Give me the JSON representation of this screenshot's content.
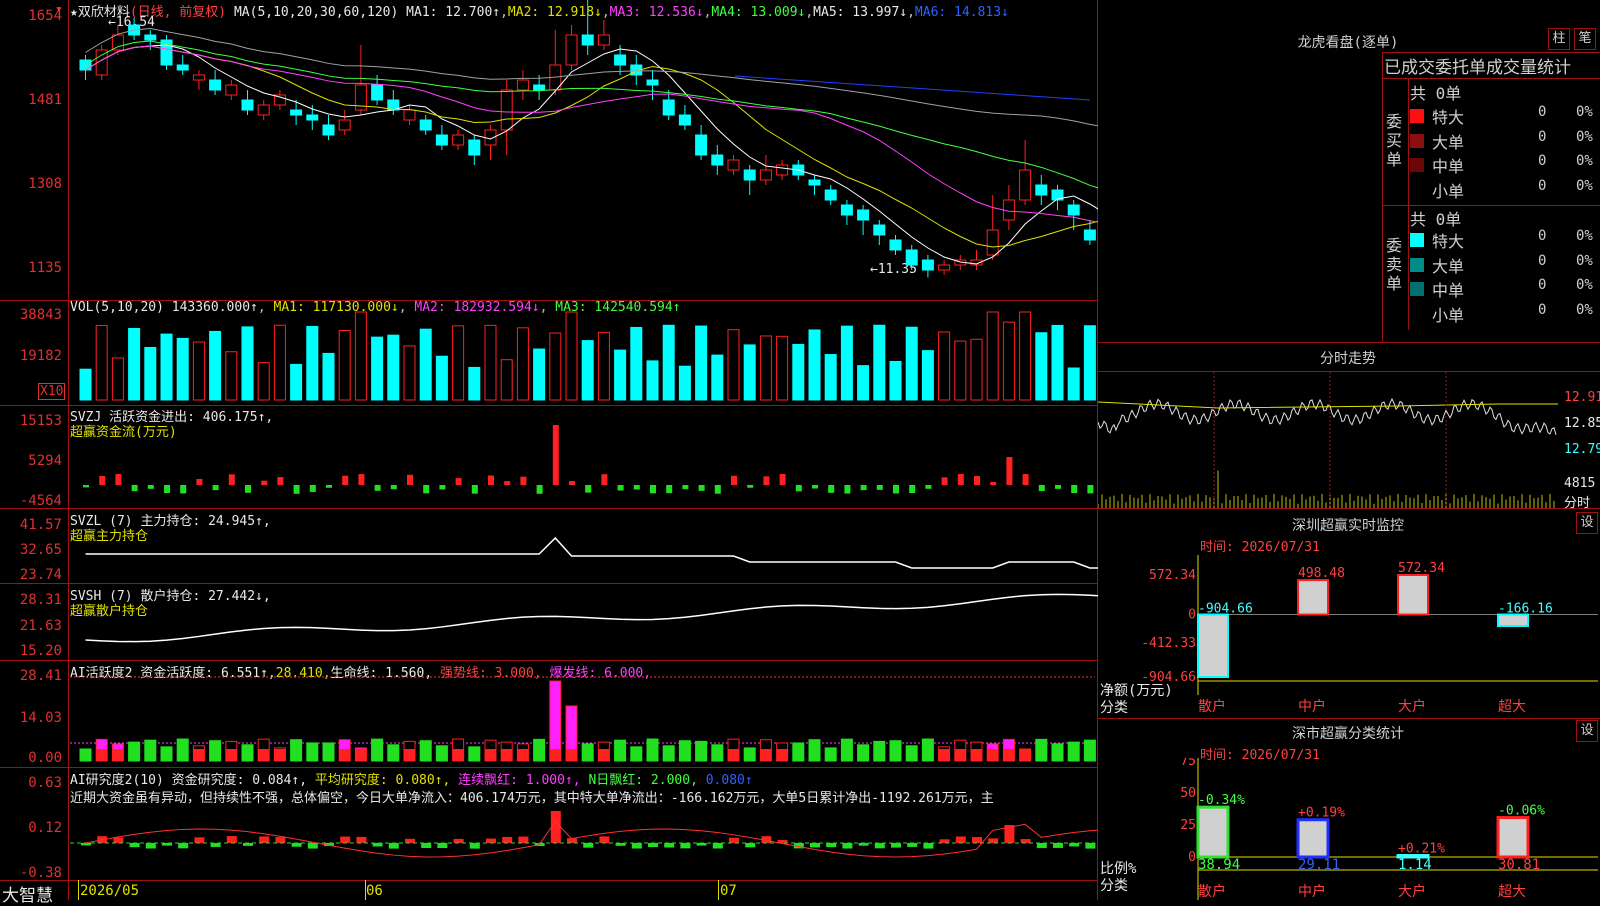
{
  "colors": {
    "up": "#ff2020",
    "down": "#00ffff",
    "ma1": "#ffffff",
    "ma2": "#e0e000",
    "ma3": "#ff40ff",
    "ma4": "#40ff40",
    "ma5": "#a0a0a0",
    "ma6": "#2040ff",
    "grid": "#a01010"
  },
  "main": {
    "stock_name": "★双欣材料",
    "mode": "(日线, 前复权)",
    "ma_params": "MA(5,10,20,30,60,120)",
    "ma1": "MA1: 12.700↑",
    "ma2": "MA2: 12.918↓",
    "ma3": "MA3: 12.536↓",
    "ma4": "MA4: 13.009↓",
    "ma5": "MA5: 13.997↓",
    "ma6": "MA6: 14.813↓",
    "y_labels": [
      "1654",
      "1481",
      "1308",
      "1135"
    ],
    "high_mark": "←16.54",
    "low_mark": "←11.35"
  },
  "volume": {
    "label": "VOL(5,10,20)",
    "value": "143360.000↑",
    "ma1": "MA1: 117130.000↓",
    "ma2": "MA2: 182932.594↓",
    "ma3": "MA3: 142540.594↑",
    "y_labels": [
      "38843",
      "19182"
    ],
    "unit": "X10"
  },
  "svzj": {
    "label": "SVZJ  活跃资金进出: 406.175↑,",
    "sub": "超赢资金流(万元)",
    "y_labels": [
      "15153",
      "5294",
      "-4564"
    ]
  },
  "svzl": {
    "label": "SVZL (7) 主力持仓: 24.945↑,",
    "sub": "超赢主力持仓",
    "y_labels": [
      "41.57",
      "32.65",
      "23.74"
    ]
  },
  "svsh": {
    "label": "SVSH (7) 散户持仓: 27.442↓,",
    "sub": "超赢散户持仓",
    "y_labels": [
      "28.31",
      "21.63",
      "15.20"
    ]
  },
  "ai_active": {
    "label1": "AI活跃度2 资金活跃度: 6.551↑,",
    "label2": "28.410,",
    "label3": "生命线: 1.560,",
    "label4": "强势线: 3.000,",
    "label5": "爆发线: 6.000,",
    "y_labels": [
      "28.41",
      "14.03",
      "0.00"
    ]
  },
  "ai_research": {
    "label1": "AI研究度2(10) 资金研究度: 0.084↑,",
    "label2": "平均研究度: 0.080↑,",
    "label3": "连续飘红: 1.000↑,",
    "label4": "N日飘红: 2.000,",
    "label5": "0.080↑",
    "comment": "近期大资金虽有异动，但持续性不强，总体偏空，今日大单净流入：406.174万元，其中特大单净流出：-166.162万元，大单5日累计净出-1192.261万元，主",
    "y_labels": [
      "0.63",
      "0.12",
      "-0.38"
    ]
  },
  "bottom": {
    "brand": "大智慧",
    "dates": [
      "2026/05",
      "06",
      "07"
    ]
  },
  "lhb": {
    "title": "龙虎看盘(逐单)",
    "btn1": "柱",
    "btn2": "笔",
    "header": "已成交委托单成交量统计",
    "buy_label": "委买单",
    "sell_label": "委卖单",
    "buy_total": "共 0单",
    "sell_total": "共 0单",
    "buy_rows": [
      {
        "name": "特大",
        "count": "0",
        "pct": "0%",
        "color": "#ff1010"
      },
      {
        "name": "大单",
        "count": "0",
        "pct": "0%",
        "color": "#8a1010"
      },
      {
        "name": "中单",
        "count": "0",
        "pct": "0%",
        "color": "#6a0808"
      },
      {
        "name": "小单",
        "count": "0",
        "pct": "0%",
        "color": "#000000"
      }
    ],
    "sell_rows": [
      {
        "name": "特大",
        "count": "0",
        "pct": "0%",
        "color": "#00ffff"
      },
      {
        "name": "大单",
        "count": "0",
        "pct": "0%",
        "color": "#008b8b"
      },
      {
        "name": "中单",
        "count": "0",
        "pct": "0%",
        "color": "#007070"
      },
      {
        "name": "小单",
        "count": "0",
        "pct": "0%",
        "color": "#000000"
      }
    ]
  },
  "intraday": {
    "title": "分时走势",
    "prices": [
      "12.91",
      "12.85",
      "12.79"
    ],
    "vol": "4815",
    "vol_unit": "分时"
  },
  "monitor": {
    "title": "深圳超赢实时监控",
    "btn": "设",
    "time": "时间: 2026/07/31",
    "y_labels": [
      "572.34",
      "0",
      "-412.33",
      "-904.66"
    ],
    "axis_label1": "净额(万元)",
    "axis_label2": "分类",
    "categories": [
      "散户",
      "中户",
      "大户",
      "超大"
    ],
    "values": [
      -904.66,
      498.48,
      572.34,
      -166.16
    ],
    "value_labels": [
      "-904.66",
      "498.48",
      "572.34",
      "-166.16"
    ]
  },
  "classify": {
    "title": "深市超赢分类统计",
    "btn": "设",
    "time": "时间: 2026/07/31",
    "y_labels": [
      "75",
      "50",
      "25",
      "0"
    ],
    "axis_label1": "比例%",
    "axis_label2": "分类",
    "categories": [
      "散户",
      "中户",
      "大户",
      "超大"
    ],
    "values": [
      38.94,
      29.11,
      1.14,
      30.81
    ],
    "changes": [
      "-0.34%",
      "+0.19%",
      "+0.21%",
      "-0.06%"
    ]
  },
  "chart_data": {
    "type": "candlestick",
    "candles": [
      [
        15.7,
        15.5,
        15.8,
        15.3
      ],
      [
        15.4,
        15.9,
        16.0,
        15.3
      ],
      [
        15.9,
        16.2,
        16.4,
        15.8
      ],
      [
        16.4,
        16.2,
        16.54,
        16.1
      ],
      [
        16.2,
        16.1,
        16.3,
        15.9
      ],
      [
        16.1,
        15.6,
        16.2,
        15.5
      ],
      [
        15.6,
        15.5,
        15.8,
        15.4
      ],
      [
        15.3,
        15.4,
        15.5,
        15.1
      ],
      [
        15.3,
        15.1,
        15.5,
        15.0
      ],
      [
        15.0,
        15.2,
        15.3,
        14.9
      ],
      [
        14.9,
        14.7,
        15.1,
        14.6
      ],
      [
        14.6,
        14.8,
        14.9,
        14.5
      ],
      [
        14.8,
        15.0,
        15.1,
        14.7
      ],
      [
        14.7,
        14.6,
        14.9,
        14.4
      ],
      [
        14.6,
        14.5,
        14.8,
        14.3
      ],
      [
        14.4,
        14.2,
        14.6,
        14.1
      ],
      [
        14.3,
        14.5,
        14.7,
        14.2
      ],
      [
        14.7,
        15.2,
        16.0,
        14.6
      ],
      [
        15.2,
        14.9,
        15.4,
        14.8
      ],
      [
        14.9,
        14.7,
        15.1,
        14.6
      ],
      [
        14.5,
        14.7,
        14.8,
        14.4
      ],
      [
        14.5,
        14.3,
        14.6,
        14.2
      ],
      [
        14.2,
        14.0,
        14.4,
        13.9
      ],
      [
        14.0,
        14.2,
        14.3,
        13.9
      ],
      [
        14.1,
        13.8,
        14.2,
        13.6
      ],
      [
        14.0,
        14.3,
        14.4,
        13.7
      ],
      [
        14.3,
        15.1,
        15.3,
        13.8
      ],
      [
        15.1,
        15.3,
        15.5,
        14.9
      ],
      [
        15.2,
        15.1,
        15.4,
        14.9
      ],
      [
        15.1,
        15.6,
        16.3,
        15.0
      ],
      [
        15.6,
        16.2,
        16.4,
        15.5
      ],
      [
        16.2,
        16.0,
        16.9,
        15.8
      ],
      [
        16.0,
        16.2,
        16.5,
        15.9
      ],
      [
        15.8,
        15.6,
        16.0,
        15.4
      ],
      [
        15.6,
        15.4,
        15.8,
        15.2
      ],
      [
        15.3,
        15.2,
        15.5,
        14.9
      ],
      [
        14.9,
        14.6,
        15.1,
        14.5
      ],
      [
        14.6,
        14.4,
        14.8,
        14.3
      ],
      [
        14.2,
        13.8,
        14.4,
        13.7
      ],
      [
        13.8,
        13.6,
        14.0,
        13.4
      ],
      [
        13.5,
        13.7,
        13.8,
        13.4
      ],
      [
        13.5,
        13.3,
        13.6,
        13.0
      ],
      [
        13.3,
        13.5,
        13.8,
        13.2
      ],
      [
        13.4,
        13.6,
        13.7,
        13.3
      ],
      [
        13.6,
        13.4,
        13.7,
        13.3
      ],
      [
        13.3,
        13.2,
        13.4,
        13.0
      ],
      [
        13.1,
        12.9,
        13.2,
        12.8
      ],
      [
        12.8,
        12.6,
        12.9,
        12.4
      ],
      [
        12.7,
        12.5,
        12.8,
        12.2
      ],
      [
        12.4,
        12.2,
        12.5,
        12.0
      ],
      [
        12.1,
        11.9,
        12.2,
        11.8
      ],
      [
        11.9,
        11.6,
        12.0,
        11.5
      ],
      [
        11.7,
        11.5,
        11.8,
        11.35
      ],
      [
        11.5,
        11.6,
        11.7,
        11.4
      ],
      [
        11.6,
        11.7,
        11.8,
        11.5
      ],
      [
        11.6,
        11.7,
        11.9,
        11.5
      ],
      [
        11.8,
        12.3,
        13.0,
        11.7
      ],
      [
        12.5,
        12.9,
        13.2,
        12.3
      ],
      [
        12.9,
        13.5,
        14.1,
        12.8
      ],
      [
        13.2,
        13.0,
        13.4,
        12.8
      ],
      [
        13.1,
        12.9,
        13.2,
        12.7
      ],
      [
        12.8,
        12.6,
        12.9,
        12.3
      ],
      [
        12.3,
        12.1,
        12.5,
        12.0
      ],
      [
        12.5,
        12.5,
        12.6,
        12.3
      ],
      [
        12.5,
        12.4,
        12.7,
        12.3
      ],
      [
        12.4,
        12.6,
        12.7,
        12.3
      ],
      [
        12.6,
        12.8,
        12.9,
        12.5
      ],
      [
        12.7,
        12.7,
        12.9,
        12.6
      ]
    ]
  }
}
